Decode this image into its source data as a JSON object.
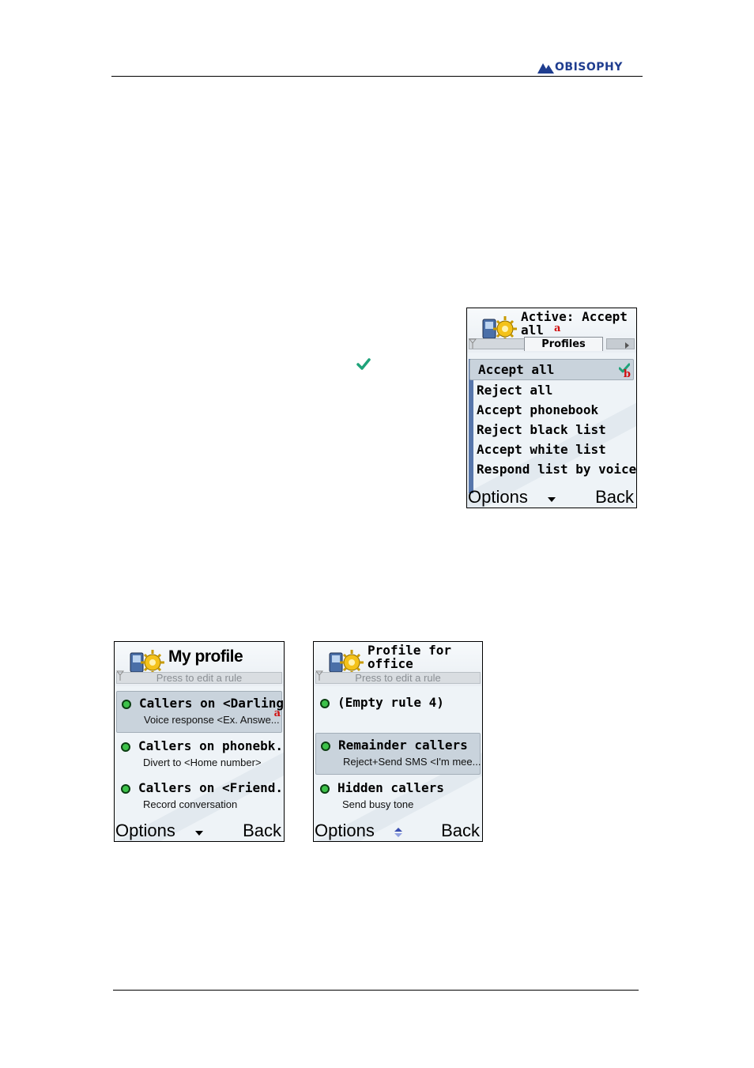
{
  "header": {
    "logo_text": "OBISOPHY"
  },
  "screens": {
    "profiles": {
      "title": "Active: Accept all",
      "title_line1": "Active: Accept",
      "title_line2": "all",
      "tab_label": "Profiles",
      "items": [
        "Accept all",
        "Reject all",
        "Accept phonebook",
        "Reject black list",
        "Accept white list",
        "Respond list by voice"
      ],
      "selected_index": 0,
      "selected_icon": "check-icon",
      "marks": {
        "a": "a",
        "b": "b"
      },
      "softkeys": {
        "left": "Options",
        "right": "Back",
        "middle_icon": "scroll-down-icon"
      }
    },
    "my_profile": {
      "title": "My profile",
      "subtitle": "Press to edit a rule",
      "rules": [
        {
          "name": "Callers on <Darling>",
          "action": "Voice response <Ex. Answe..."
        },
        {
          "name": "Callers on phonebk.",
          "action": "Divert to <Home number>"
        },
        {
          "name": "Callers on <Friend...",
          "action": "Record conversation"
        }
      ],
      "selected_index": 0,
      "mark": "a",
      "softkeys": {
        "left": "Options",
        "right": "Back",
        "middle_icon": "scroll-down-icon"
      }
    },
    "office_profile": {
      "title_line1": "Profile for",
      "title_line2": "office",
      "subtitle": "Press to edit a rule",
      "rules": [
        {
          "name": "(Empty rule 4)",
          "action": ""
        },
        {
          "name": "Remainder callers",
          "action": "Reject+Send SMS <I'm mee..."
        },
        {
          "name": "Hidden callers",
          "action": "Send busy tone"
        }
      ],
      "selected_index": 1,
      "softkeys": {
        "left": "Options",
        "right": "Back",
        "middle_icon": "scroll-updown-icon"
      }
    }
  },
  "document_icons": {
    "inline_check": "check-icon"
  },
  "colors": {
    "check": "#1fa37a",
    "mark": "#d01010",
    "dot": "#3dc24a",
    "logo": "#1f3d8f"
  }
}
